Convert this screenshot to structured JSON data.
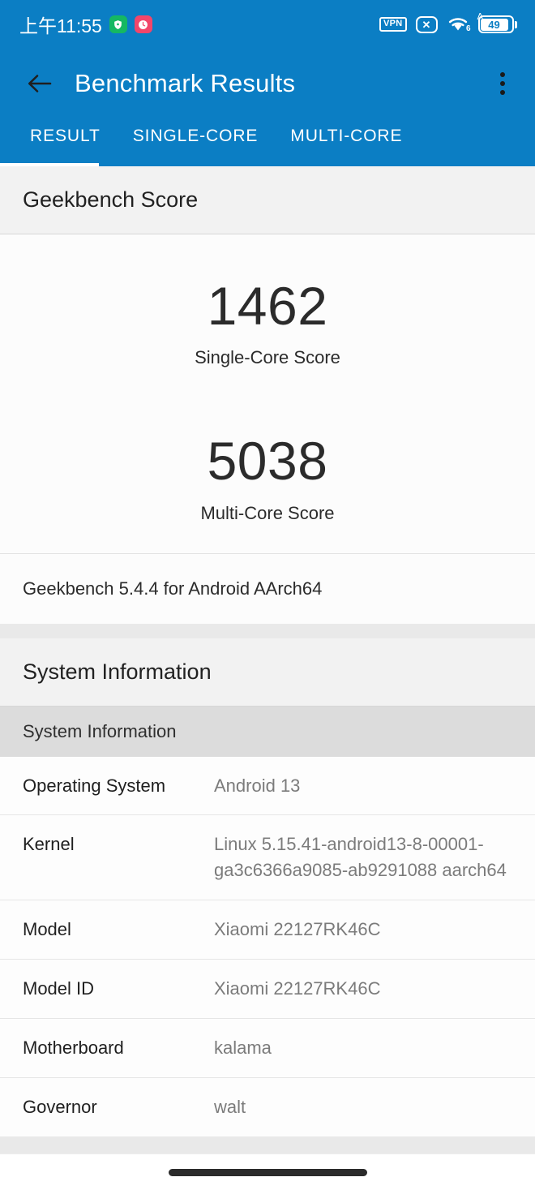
{
  "status_bar": {
    "time": "上午11:55",
    "icons": [
      "shield-app-icon",
      "clock-app-icon"
    ],
    "vpn_label": "VPN",
    "mute_label": "✕",
    "wifi_generation": "6",
    "battery_percent": "49"
  },
  "app_bar": {
    "back_icon": "back-arrow-icon",
    "title": "Benchmark Results",
    "overflow_icon": "more-vertical-icon",
    "tabs": [
      {
        "label": "RESULT",
        "active": true
      },
      {
        "label": "SINGLE-CORE",
        "active": false
      },
      {
        "label": "MULTI-CORE",
        "active": false
      }
    ]
  },
  "score_section": {
    "header": "Geekbench Score",
    "scores": [
      {
        "value": "1462",
        "label": "Single-Core Score"
      },
      {
        "value": "5038",
        "label": "Multi-Core Score"
      }
    ],
    "version": "Geekbench 5.4.4 for Android AArch64"
  },
  "system_section": {
    "header": "System Information",
    "subheader": "System Information",
    "rows": [
      {
        "key": "Operating System",
        "value": "Android 13"
      },
      {
        "key": "Kernel",
        "value": "Linux 5.15.41-android13-8-00001-ga3c6366a9085-ab9291088 aarch64"
      },
      {
        "key": "Model",
        "value": "Xiaomi 22127RK46C"
      },
      {
        "key": "Model ID",
        "value": "Xiaomi 22127RK46C"
      },
      {
        "key": "Motherboard",
        "value": "kalama"
      },
      {
        "key": "Governor",
        "value": "walt"
      }
    ]
  },
  "nav_bar": {
    "pill": "home-gesture-pill"
  },
  "colors": {
    "brand_blue": "#0b7ec4",
    "page_bg": "#e9e9e9",
    "card_bg": "#fdfdfd",
    "section_head_bg": "#f2f2f2",
    "subhead_bg": "#dcdcdc",
    "value_text": "#7b7b7b"
  }
}
